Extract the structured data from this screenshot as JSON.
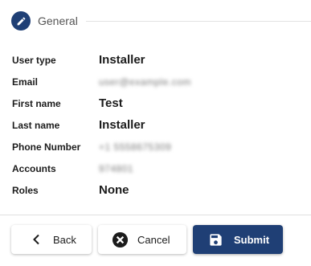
{
  "section": {
    "title": "General",
    "icon": "pencil-icon"
  },
  "fields": [
    {
      "label": "User type",
      "value": "Installer",
      "redacted": false
    },
    {
      "label": "Email",
      "value": "user@example.com",
      "redacted": true
    },
    {
      "label": "First name",
      "value": "Test",
      "redacted": false
    },
    {
      "label": "Last name",
      "value": "Installer",
      "redacted": false
    },
    {
      "label": "Phone Number",
      "value": "+1 5558675309",
      "redacted": true
    },
    {
      "label": "Accounts",
      "value": "974801",
      "redacted": true
    },
    {
      "label": "Roles",
      "value": "None",
      "redacted": false
    }
  ],
  "actions": {
    "back_label": "Back",
    "cancel_label": "Cancel",
    "submit_label": "Submit"
  },
  "colors": {
    "primary": "#1f3f75",
    "text": "#1c1c1c"
  }
}
